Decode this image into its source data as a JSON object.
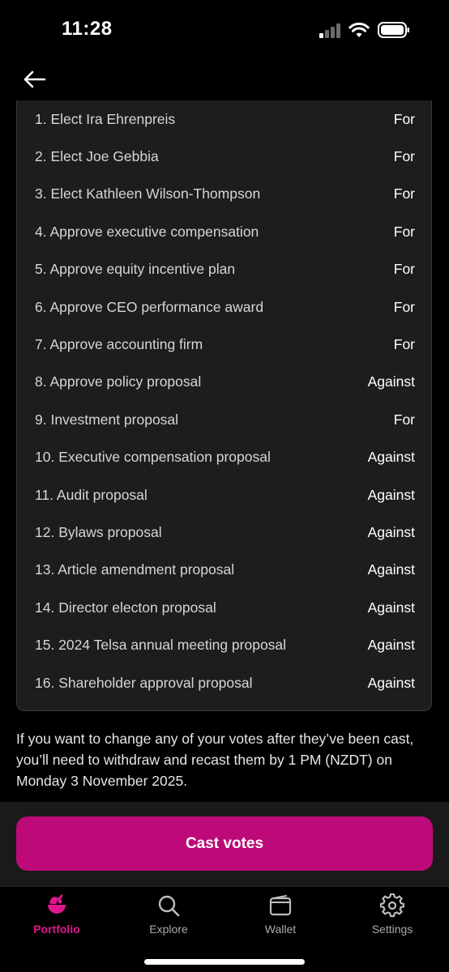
{
  "status_bar": {
    "time": "11:28"
  },
  "votes": [
    {
      "label": "1. Elect Ira Ehrenpreis",
      "value": "For"
    },
    {
      "label": "2. Elect Joe Gebbia",
      "value": "For"
    },
    {
      "label": "3. Elect Kathleen Wilson-Thompson",
      "value": "For"
    },
    {
      "label": "4. Approve executive compensation",
      "value": "For"
    },
    {
      "label": "5. Approve equity incentive plan",
      "value": "For"
    },
    {
      "label": "6. Approve CEO performance award",
      "value": "For"
    },
    {
      "label": "7. Approve accounting firm",
      "value": "For"
    },
    {
      "label": "8. Approve policy proposal",
      "value": "Against"
    },
    {
      "label": "9. Investment proposal",
      "value": "For"
    },
    {
      "label": "10. Executive compensation proposal",
      "value": "Against"
    },
    {
      "label": "11. Audit proposal",
      "value": "Against"
    },
    {
      "label": "12. Bylaws proposal",
      "value": "Against"
    },
    {
      "label": "13. Article amendment proposal",
      "value": "Against"
    },
    {
      "label": "14. Director electon proposal",
      "value": "Against"
    },
    {
      "label": "15. 2024 Telsa annual meeting proposal",
      "value": "Against"
    },
    {
      "label": "16. Shareholder approval proposal",
      "value": "Against"
    }
  ],
  "notice": "If you want to change any of your votes after they’ve been cast, you’ll need to withdraw and recast them by 1 PM (NZDT) on Monday 3 November 2025.",
  "cast_button": "Cast votes",
  "tabs": [
    {
      "label": "Portfolio",
      "icon": "portfolio-icon",
      "active": true
    },
    {
      "label": "Explore",
      "icon": "search-icon",
      "active": false
    },
    {
      "label": "Wallet",
      "icon": "wallet-icon",
      "active": false
    },
    {
      "label": "Settings",
      "icon": "gear-icon",
      "active": false
    }
  ],
  "colors": {
    "accent": "#bd0a78",
    "accent_text": "#e0178c",
    "card": "#1d1c1e",
    "background": "#000000"
  }
}
